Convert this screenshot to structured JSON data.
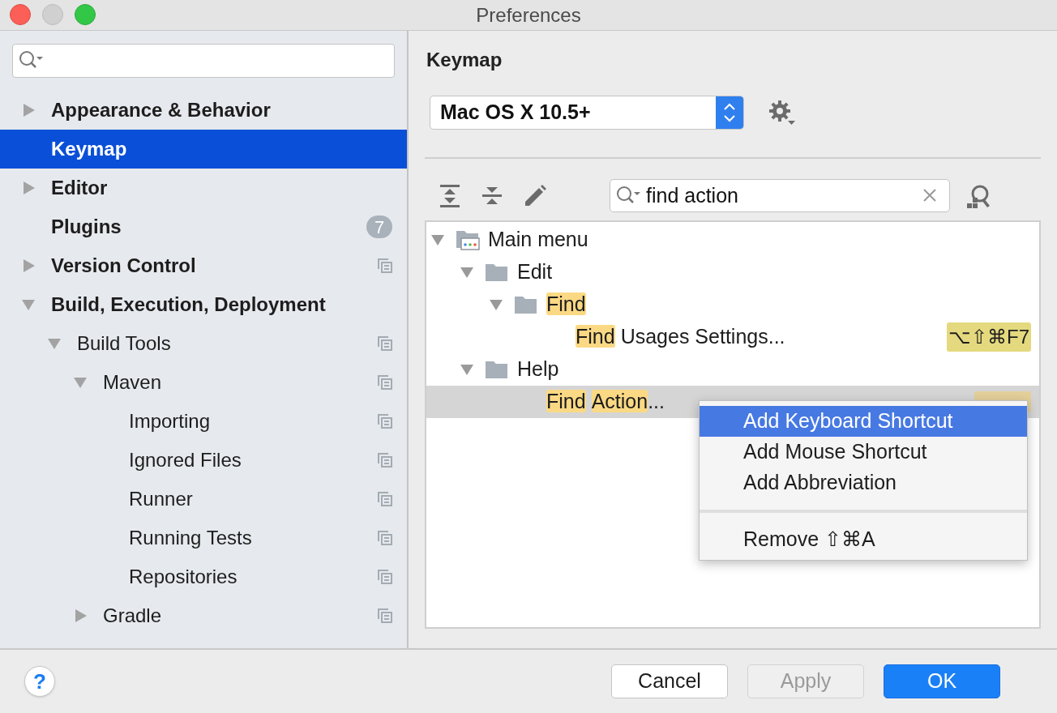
{
  "window": {
    "title": "Preferences"
  },
  "sidebar": {
    "items": [
      {
        "label": "Appearance & Behavior",
        "kind": "group",
        "expanded": false,
        "selected": false,
        "project_scope": false
      },
      {
        "label": "Keymap",
        "kind": "leaf",
        "selected": true,
        "project_scope": false
      },
      {
        "label": "Editor",
        "kind": "group",
        "expanded": false,
        "selected": false,
        "project_scope": false
      },
      {
        "label": "Plugins",
        "kind": "leaf",
        "selected": false,
        "project_scope": false,
        "badge": "7"
      },
      {
        "label": "Version Control",
        "kind": "group",
        "expanded": false,
        "selected": false,
        "project_scope": true
      },
      {
        "label": "Build, Execution, Deployment",
        "kind": "group",
        "expanded": true,
        "selected": false,
        "project_scope": false,
        "children": [
          {
            "label": "Build Tools",
            "kind": "group",
            "expanded": true,
            "selected": false,
            "project_scope": true,
            "children": [
              {
                "label": "Maven",
                "kind": "group",
                "expanded": true,
                "selected": false,
                "project_scope": true,
                "children": [
                  {
                    "label": "Importing",
                    "kind": "leaf",
                    "selected": false,
                    "project_scope": true
                  },
                  {
                    "label": "Ignored Files",
                    "kind": "leaf",
                    "selected": false,
                    "project_scope": true
                  },
                  {
                    "label": "Runner",
                    "kind": "leaf",
                    "selected": false,
                    "project_scope": true
                  },
                  {
                    "label": "Running Tests",
                    "kind": "leaf",
                    "selected": false,
                    "project_scope": true
                  },
                  {
                    "label": "Repositories",
                    "kind": "leaf",
                    "selected": false,
                    "project_scope": true
                  }
                ]
              },
              {
                "label": "Gradle",
                "kind": "group",
                "expanded": false,
                "selected": false,
                "project_scope": true
              }
            ]
          }
        ]
      }
    ]
  },
  "panel": {
    "title": "Keymap",
    "keymap_select": "Mac OS X 10.5+",
    "filter": {
      "value": "find action"
    },
    "tree": [
      {
        "kind": "menu",
        "parts": [
          {
            "text": "Main menu",
            "match": false
          }
        ],
        "expanded": true,
        "selected": false,
        "children": [
          {
            "kind": "folder",
            "parts": [
              {
                "text": "Edit",
                "match": false
              }
            ],
            "expanded": true,
            "selected": false,
            "children": [
              {
                "kind": "folder",
                "parts": [
                  {
                    "text": "Find",
                    "match": true
                  }
                ],
                "expanded": true,
                "selected": false,
                "children": [
                  {
                    "kind": "action",
                    "parts": [
                      {
                        "text": "Find",
                        "match": true
                      },
                      {
                        "text": "Usages Settings...",
                        "match": false,
                        "space_before": true
                      }
                    ],
                    "selected": false,
                    "shortcut": "⌥⇧⌘F7"
                  }
                ]
              }
            ]
          },
          {
            "kind": "folder",
            "parts": [
              {
                "text": "Help",
                "match": false
              }
            ],
            "expanded": true,
            "selected": false,
            "children": [
              {
                "kind": "action",
                "parts": [
                  {
                    "text": "Find",
                    "match": true
                  },
                  {
                    "text": "Action",
                    "match": true,
                    "space_before": true
                  },
                  {
                    "text": "...",
                    "match": false
                  }
                ],
                "selected": true,
                "shortcut_hidden": true
              }
            ]
          }
        ]
      }
    ],
    "context_menu": [
      {
        "label": "Add Keyboard Shortcut",
        "selected": true,
        "separator_before": false
      },
      {
        "label": "Add Mouse Shortcut",
        "selected": false,
        "separator_before": false
      },
      {
        "label": "Add Abbreviation",
        "selected": false,
        "separator_before": false
      },
      {
        "label": "Remove ⇧⌘A",
        "selected": false,
        "separator_before": true
      }
    ]
  },
  "help_button": "?",
  "buttons": [
    {
      "label": "Cancel",
      "kind": "normal"
    },
    {
      "label": "Apply",
      "kind": "disabled"
    },
    {
      "label": "OK",
      "kind": "default"
    }
  ]
}
